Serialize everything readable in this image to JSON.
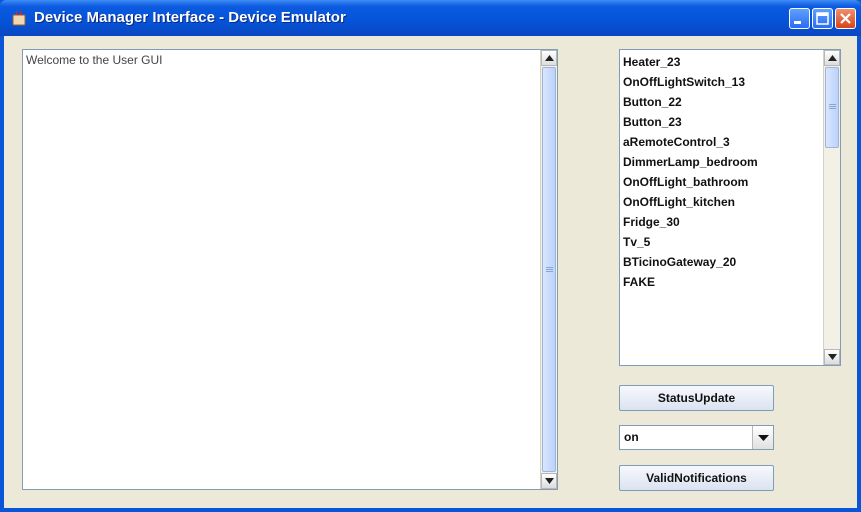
{
  "window": {
    "title": "Device Manager Interface - Device Emulator",
    "controls": [
      "minimize-icon",
      "maximize-icon",
      "close-icon"
    ],
    "accent": "#0553d8"
  },
  "console": {
    "text": "Welcome to the User GUI"
  },
  "device_list": {
    "items": [
      "Heater_23",
      "OnOffLightSwitch_13",
      "Button_22",
      "Button_23",
      "aRemoteControl_3",
      "DimmerLamp_bedroom",
      "OnOffLight_bathroom",
      "OnOffLight_kitchen",
      "Fridge_30",
      "Tv_5",
      "BTicinoGateway_20",
      "FAKE"
    ]
  },
  "controls": {
    "status_update_label": "StatusUpdate",
    "state_selected": "on",
    "valid_notifications_label": "ValidNotifications"
  }
}
